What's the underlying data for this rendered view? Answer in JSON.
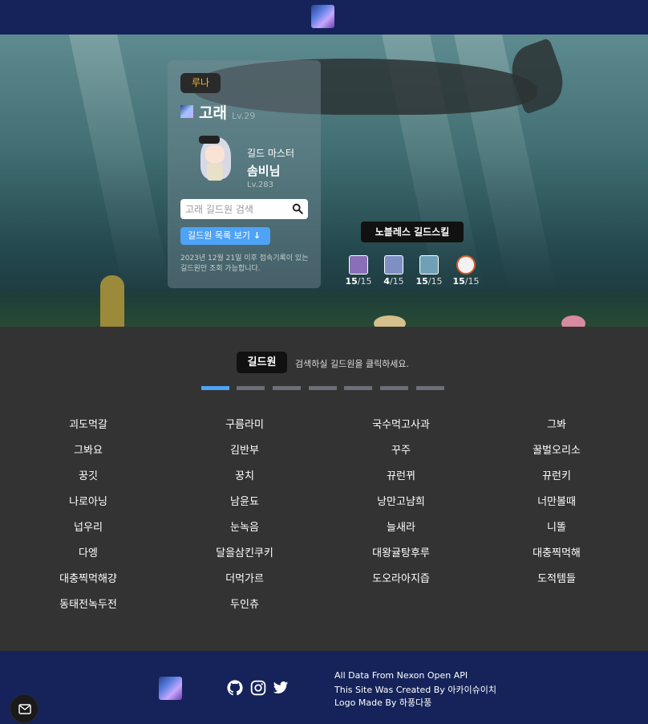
{
  "header": {
    "logo_icon": "guild-logo-icon"
  },
  "guild": {
    "world": "루나",
    "name": "고래",
    "level": "Lv.29",
    "master_label": "길드 마스터",
    "master_name": "솜비님",
    "master_level": "Lv.283"
  },
  "search": {
    "placeholder": "고래 길드원 검색"
  },
  "members_button": {
    "label": "길드원 목록 보기"
  },
  "note": "2023년 12월 21일 이후 접속기록이 있는 길드원만 조회 가능합니다.",
  "skills": {
    "title": "노블레스 길드스킬",
    "items": [
      {
        "current": "15",
        "max": "/15",
        "color": "#8a6fb8"
      },
      {
        "current": "4",
        "max": "/15",
        "color": "#7e8fc4"
      },
      {
        "current": "15",
        "max": "/15",
        "color": "#6fa0b8"
      },
      {
        "current": "15",
        "max": "/15",
        "color": "#f2f2f2"
      }
    ]
  },
  "members_section": {
    "tab": "길드원",
    "hint": "검색하실 길드원을 클릭하세요.",
    "pages": 7,
    "active_page": 1,
    "names": [
      "괴도먹갈",
      "구름라미",
      "국수먹고사과",
      "그봐",
      "그봐요",
      "김반부",
      "꾸주",
      "꿀벌오리소",
      "꿍깃",
      "꿍치",
      "뀨런뀌",
      "뀨런키",
      "나로아닝",
      "남윤됴",
      "낭만고냠희",
      "너만볼때",
      "넙우리",
      "눈녹음",
      "늘새라",
      "니똘",
      "다엥",
      "달을삼킨쿠키",
      "대왕귤탕후루",
      "대충찍먹해",
      "대충찍먹해걍",
      "더먹가르",
      "도오라아지즙",
      "도적템들",
      "동태전녹두전",
      "두인츄"
    ]
  },
  "footer": {
    "credits": [
      "All Data From Nexon Open API",
      "This Site Was Created By 아카이슈이치",
      "Logo Made By 하풍다풍"
    ],
    "social": [
      "github-icon",
      "instagram-icon",
      "twitter-icon"
    ]
  }
}
